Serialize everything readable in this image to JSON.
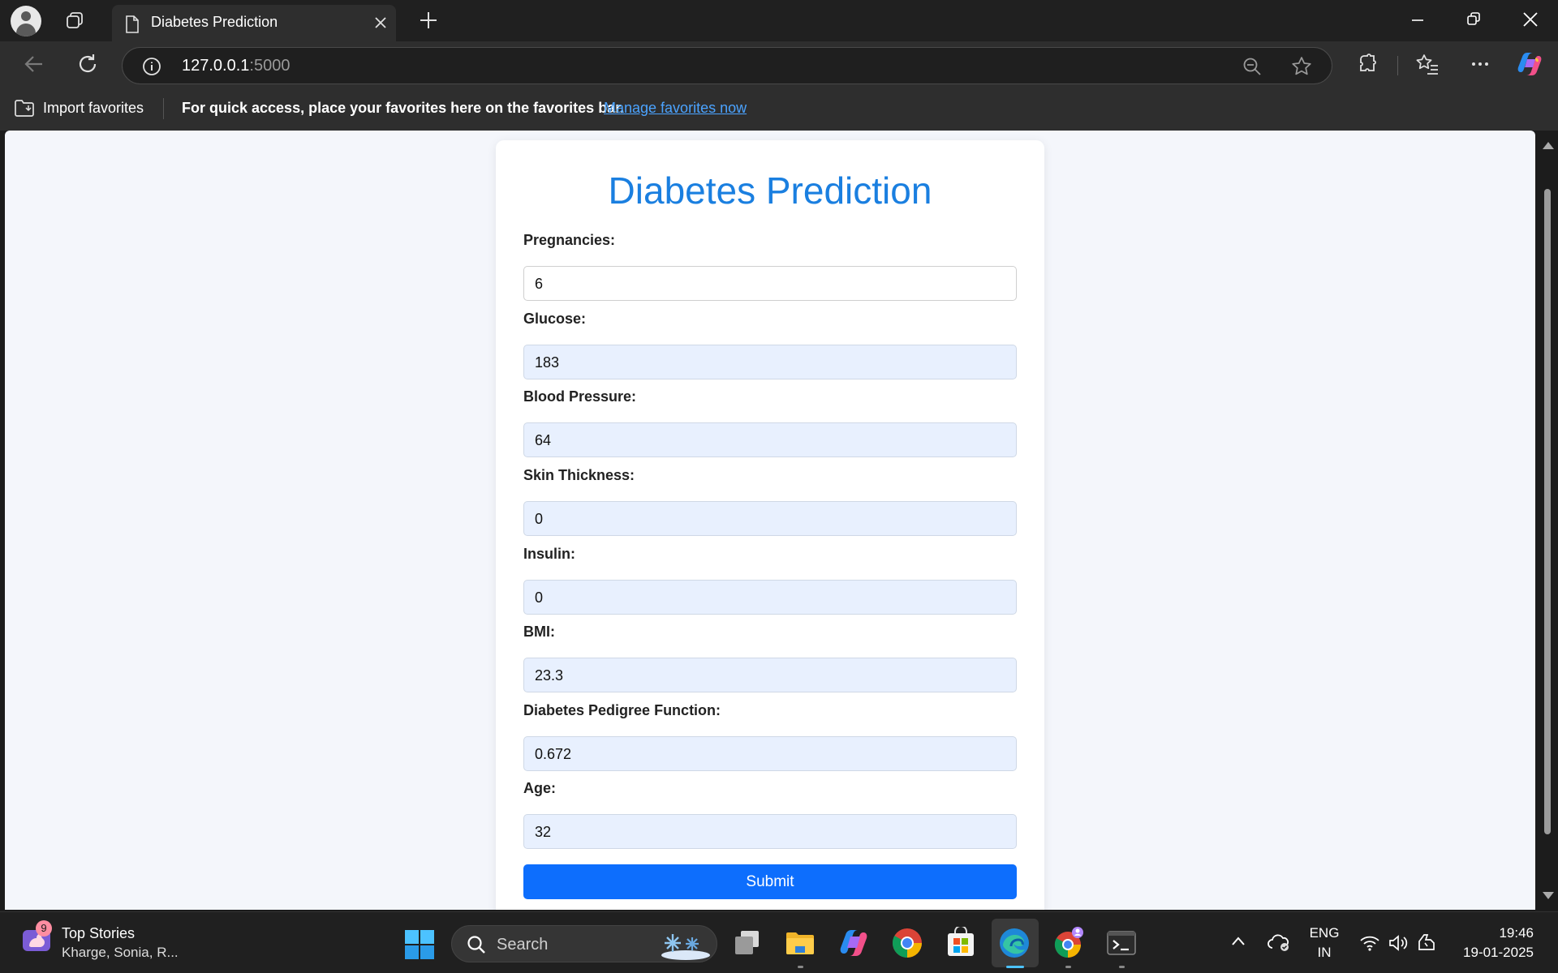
{
  "browser": {
    "tab_title": "Diabetes Prediction",
    "url_host": "127.0.0.1",
    "url_port": ":5000",
    "favorites_bar": {
      "import_label": "Import favorites",
      "hint": "For quick access, place your favorites here on the favorites bar.",
      "manage_link": "Manage favorites now"
    }
  },
  "page": {
    "heading": "Diabetes Prediction",
    "heading_color": "#1a7fe0",
    "fields": [
      {
        "label": "Pregnancies:",
        "value": "6"
      },
      {
        "label": "Glucose:",
        "value": "183"
      },
      {
        "label": "Blood Pressure:",
        "value": "64"
      },
      {
        "label": "Skin Thickness:",
        "value": "0"
      },
      {
        "label": "Insulin:",
        "value": "0"
      },
      {
        "label": "BMI:",
        "value": "23.3"
      },
      {
        "label": "Diabetes Pedigree Function:",
        "value": "0.672"
      },
      {
        "label": "Age:",
        "value": "32"
      }
    ],
    "submit_label": "Submit",
    "submit_color": "#0d6efd"
  },
  "taskbar": {
    "news_badge": "9",
    "news_title": "Top Stories",
    "news_sub": "Kharge, Sonia, R...",
    "search_label": "Search",
    "lang_top": "ENG",
    "lang_bottom": "IN",
    "time": "19:46",
    "date": "19-01-2025",
    "icons": [
      "task-view-icon",
      "file-explorer-icon",
      "copilot-icon",
      "chrome-icon",
      "store-icon",
      "edge-icon",
      "chrome-profile-icon",
      "terminal-icon"
    ]
  }
}
